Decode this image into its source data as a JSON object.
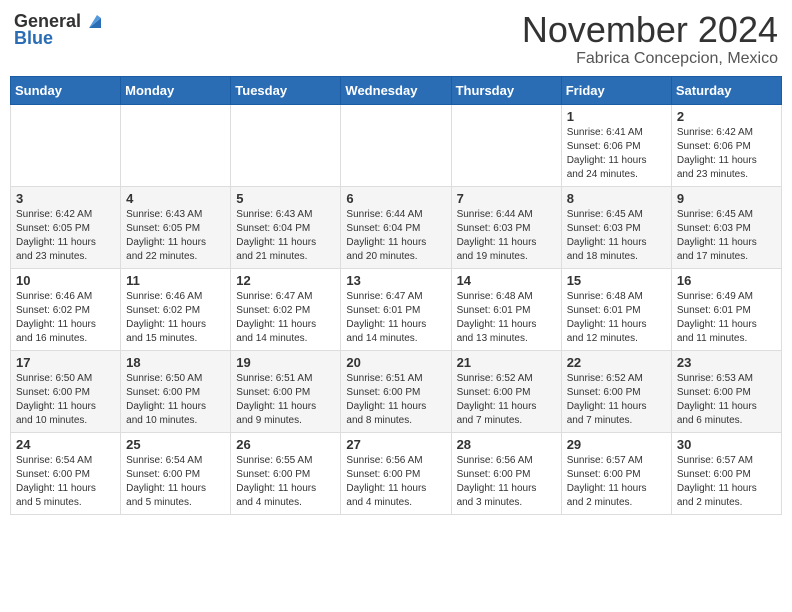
{
  "header": {
    "logo_general": "General",
    "logo_blue": "Blue",
    "month": "November 2024",
    "location": "Fabrica Concepcion, Mexico"
  },
  "weekdays": [
    "Sunday",
    "Monday",
    "Tuesday",
    "Wednesday",
    "Thursday",
    "Friday",
    "Saturday"
  ],
  "weeks": [
    [
      {
        "day": "",
        "info": ""
      },
      {
        "day": "",
        "info": ""
      },
      {
        "day": "",
        "info": ""
      },
      {
        "day": "",
        "info": ""
      },
      {
        "day": "",
        "info": ""
      },
      {
        "day": "1",
        "info": "Sunrise: 6:41 AM\nSunset: 6:06 PM\nDaylight: 11 hours and 24 minutes."
      },
      {
        "day": "2",
        "info": "Sunrise: 6:42 AM\nSunset: 6:06 PM\nDaylight: 11 hours and 23 minutes."
      }
    ],
    [
      {
        "day": "3",
        "info": "Sunrise: 6:42 AM\nSunset: 6:05 PM\nDaylight: 11 hours and 23 minutes."
      },
      {
        "day": "4",
        "info": "Sunrise: 6:43 AM\nSunset: 6:05 PM\nDaylight: 11 hours and 22 minutes."
      },
      {
        "day": "5",
        "info": "Sunrise: 6:43 AM\nSunset: 6:04 PM\nDaylight: 11 hours and 21 minutes."
      },
      {
        "day": "6",
        "info": "Sunrise: 6:44 AM\nSunset: 6:04 PM\nDaylight: 11 hours and 20 minutes."
      },
      {
        "day": "7",
        "info": "Sunrise: 6:44 AM\nSunset: 6:03 PM\nDaylight: 11 hours and 19 minutes."
      },
      {
        "day": "8",
        "info": "Sunrise: 6:45 AM\nSunset: 6:03 PM\nDaylight: 11 hours and 18 minutes."
      },
      {
        "day": "9",
        "info": "Sunrise: 6:45 AM\nSunset: 6:03 PM\nDaylight: 11 hours and 17 minutes."
      }
    ],
    [
      {
        "day": "10",
        "info": "Sunrise: 6:46 AM\nSunset: 6:02 PM\nDaylight: 11 hours and 16 minutes."
      },
      {
        "day": "11",
        "info": "Sunrise: 6:46 AM\nSunset: 6:02 PM\nDaylight: 11 hours and 15 minutes."
      },
      {
        "day": "12",
        "info": "Sunrise: 6:47 AM\nSunset: 6:02 PM\nDaylight: 11 hours and 14 minutes."
      },
      {
        "day": "13",
        "info": "Sunrise: 6:47 AM\nSunset: 6:01 PM\nDaylight: 11 hours and 14 minutes."
      },
      {
        "day": "14",
        "info": "Sunrise: 6:48 AM\nSunset: 6:01 PM\nDaylight: 11 hours and 13 minutes."
      },
      {
        "day": "15",
        "info": "Sunrise: 6:48 AM\nSunset: 6:01 PM\nDaylight: 11 hours and 12 minutes."
      },
      {
        "day": "16",
        "info": "Sunrise: 6:49 AM\nSunset: 6:01 PM\nDaylight: 11 hours and 11 minutes."
      }
    ],
    [
      {
        "day": "17",
        "info": "Sunrise: 6:50 AM\nSunset: 6:00 PM\nDaylight: 11 hours and 10 minutes."
      },
      {
        "day": "18",
        "info": "Sunrise: 6:50 AM\nSunset: 6:00 PM\nDaylight: 11 hours and 10 minutes."
      },
      {
        "day": "19",
        "info": "Sunrise: 6:51 AM\nSunset: 6:00 PM\nDaylight: 11 hours and 9 minutes."
      },
      {
        "day": "20",
        "info": "Sunrise: 6:51 AM\nSunset: 6:00 PM\nDaylight: 11 hours and 8 minutes."
      },
      {
        "day": "21",
        "info": "Sunrise: 6:52 AM\nSunset: 6:00 PM\nDaylight: 11 hours and 7 minutes."
      },
      {
        "day": "22",
        "info": "Sunrise: 6:52 AM\nSunset: 6:00 PM\nDaylight: 11 hours and 7 minutes."
      },
      {
        "day": "23",
        "info": "Sunrise: 6:53 AM\nSunset: 6:00 PM\nDaylight: 11 hours and 6 minutes."
      }
    ],
    [
      {
        "day": "24",
        "info": "Sunrise: 6:54 AM\nSunset: 6:00 PM\nDaylight: 11 hours and 5 minutes."
      },
      {
        "day": "25",
        "info": "Sunrise: 6:54 AM\nSunset: 6:00 PM\nDaylight: 11 hours and 5 minutes."
      },
      {
        "day": "26",
        "info": "Sunrise: 6:55 AM\nSunset: 6:00 PM\nDaylight: 11 hours and 4 minutes."
      },
      {
        "day": "27",
        "info": "Sunrise: 6:56 AM\nSunset: 6:00 PM\nDaylight: 11 hours and 4 minutes."
      },
      {
        "day": "28",
        "info": "Sunrise: 6:56 AM\nSunset: 6:00 PM\nDaylight: 11 hours and 3 minutes."
      },
      {
        "day": "29",
        "info": "Sunrise: 6:57 AM\nSunset: 6:00 PM\nDaylight: 11 hours and 2 minutes."
      },
      {
        "day": "30",
        "info": "Sunrise: 6:57 AM\nSunset: 6:00 PM\nDaylight: 11 hours and 2 minutes."
      }
    ]
  ]
}
